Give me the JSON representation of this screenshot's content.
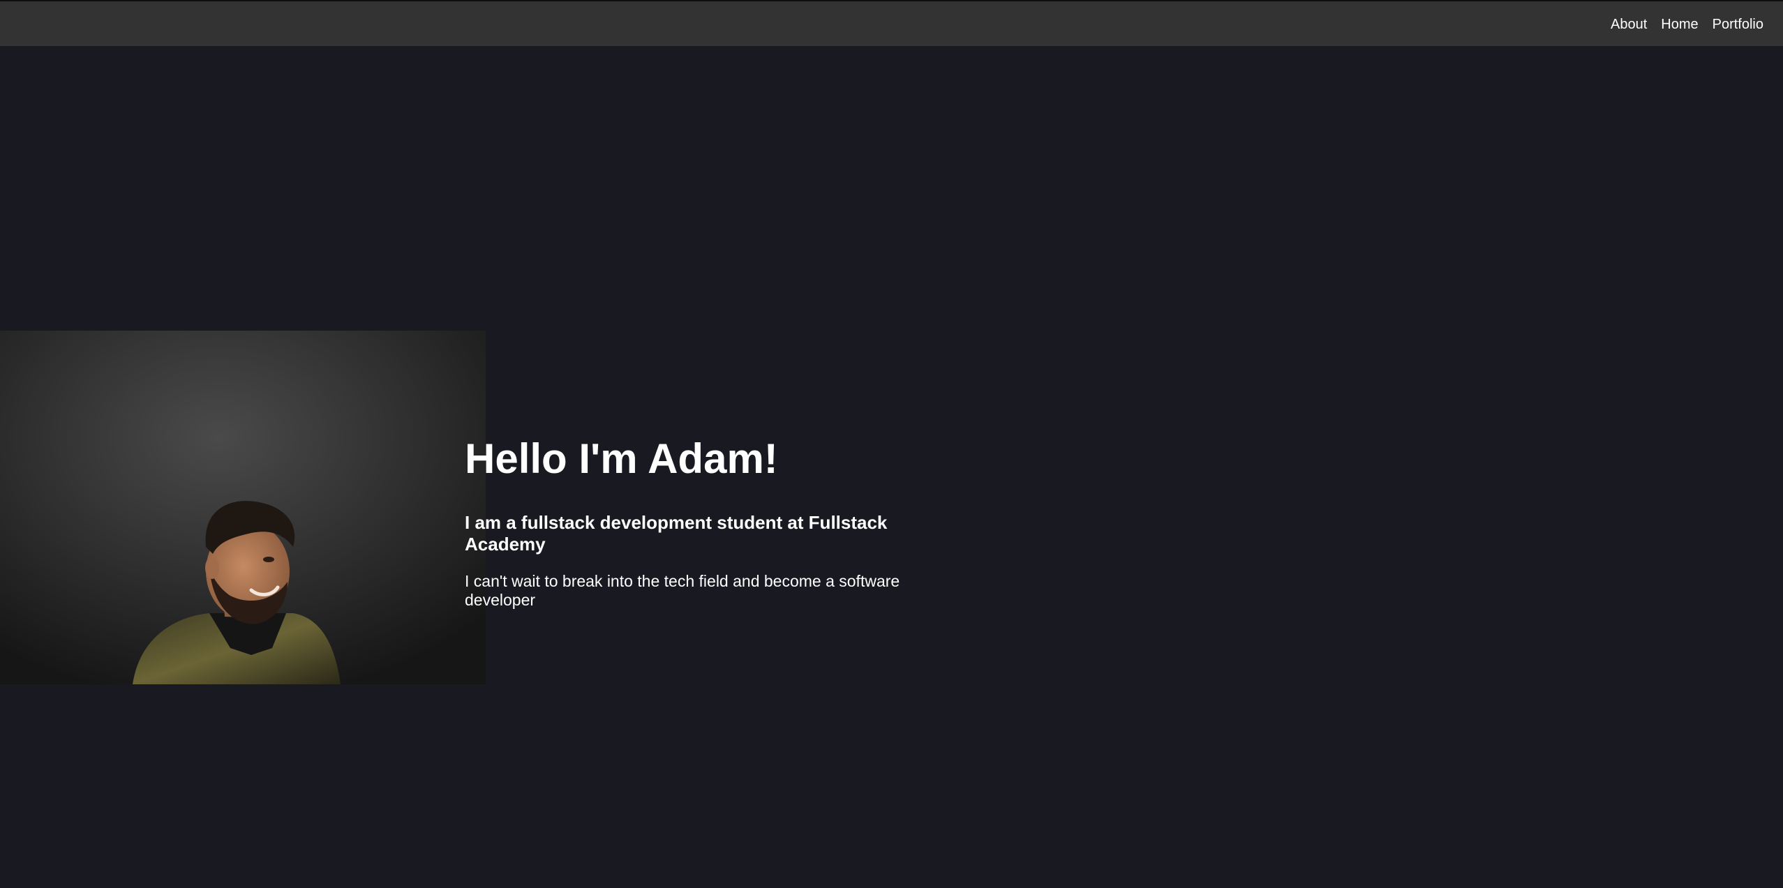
{
  "nav": {
    "items": [
      {
        "label": "About"
      },
      {
        "label": "Home"
      },
      {
        "label": "Portfolio"
      }
    ]
  },
  "hero": {
    "heading": "Hello I'm Adam!",
    "subheading": "I am a fullstack development student at Fullstack Academy",
    "text": "I can't wait to break into the tech field and become a software developer"
  },
  "colors": {
    "page_background": "#191921",
    "nav_background": "#333333",
    "text": "#ffffff"
  }
}
